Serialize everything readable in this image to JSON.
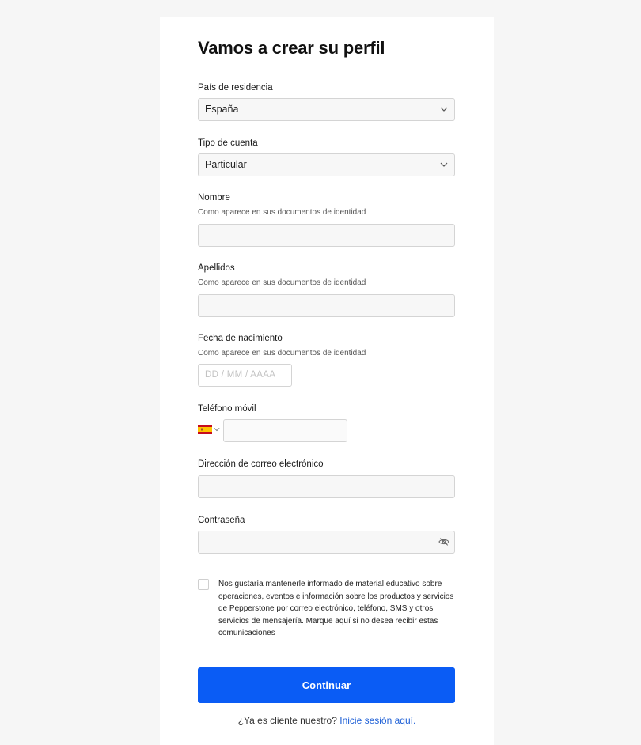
{
  "form": {
    "title": "Vamos a crear su perfil",
    "country": {
      "label": "País de residencia",
      "value": "España"
    },
    "account_type": {
      "label": "Tipo de cuenta",
      "value": "Particular"
    },
    "first_name": {
      "label": "Nombre",
      "hint": "Como aparece en sus documentos de identidad",
      "value": ""
    },
    "last_name": {
      "label": "Apellidos",
      "hint": "Como aparece en sus documentos de identidad",
      "value": ""
    },
    "birth_date": {
      "label": "Fecha de nacimiento",
      "hint": "Como aparece en sus documentos de identidad",
      "placeholder": "DD / MM / AAAA",
      "value": ""
    },
    "phone": {
      "label": "Teléfono móvil",
      "country_flag": "spain-flag-icon",
      "value": ""
    },
    "email": {
      "label": "Dirección de correo electrónico",
      "value": ""
    },
    "password": {
      "label": "Contraseña",
      "value": "",
      "toggle_icon": "eye-slash-icon"
    },
    "consent": {
      "checked": false,
      "text": "Nos gustaría mantenerle informado de material educativo sobre operaciones, eventos e información sobre los productos y servicios de Pepperstone por correo electrónico, teléfono, SMS y otros servicios de mensajería. Marque aquí si no desea recibir estas comunicaciones"
    },
    "submit_label": "Continuar",
    "footer": {
      "question": "¿Ya es cliente nuestro?",
      "link": "Inicie sesión aquí."
    }
  },
  "colors": {
    "primary": "#0a5cf5",
    "link": "#1d5fd6",
    "background": "#f6f6f6"
  }
}
